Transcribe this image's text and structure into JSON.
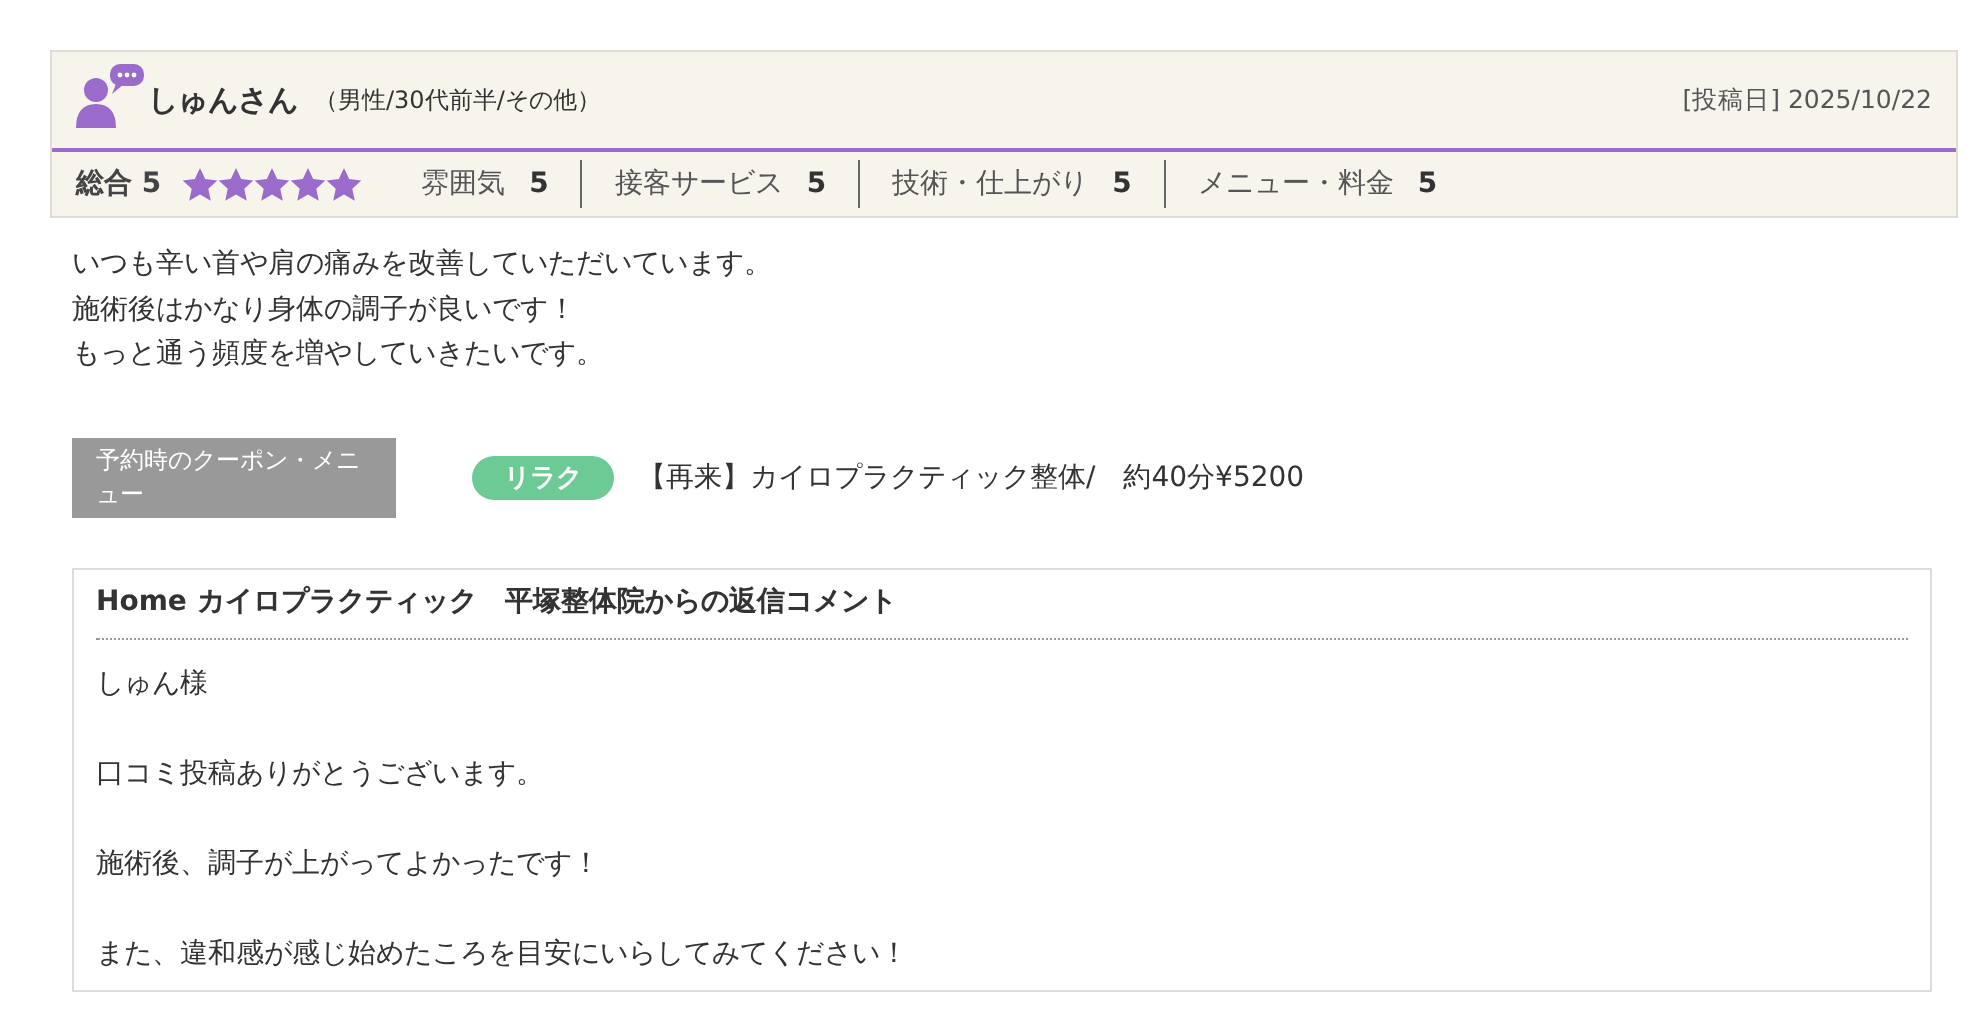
{
  "review": {
    "author": "しゅんさん",
    "profile": "（男性/30代前半/その他）",
    "posted_label": "[投稿日]",
    "posted_date": "2025/10/22",
    "overall": {
      "label": "総合",
      "score": "5",
      "stars": 5
    },
    "ratings": [
      {
        "label": "雰囲気",
        "score": "5"
      },
      {
        "label": "接客サービス",
        "score": "5"
      },
      {
        "label": "技術・仕上がり",
        "score": "5"
      },
      {
        "label": "メニュー・料金",
        "score": "5"
      }
    ],
    "body": [
      "いつも辛い首や肩の痛みを改善していただいています。",
      "施術後はかなり身体の調子が良いです！",
      "もっと通う頻度を増やしていきたいです。"
    ],
    "coupon": {
      "label": "予約時のクーポン・メニュー",
      "tag": "リラク",
      "text": "【再来】カイロプラクティック整体/　約40分¥5200"
    }
  },
  "reply": {
    "title": "Home カイロプラクティック　平塚整体院からの返信コメント",
    "paragraphs": [
      "しゅん様",
      "口コミ投稿ありがとうございます。",
      "施術後、調子が上がってよかったです！",
      "また、違和感が感じ始めたころを目安にいらしてみてください！"
    ]
  }
}
